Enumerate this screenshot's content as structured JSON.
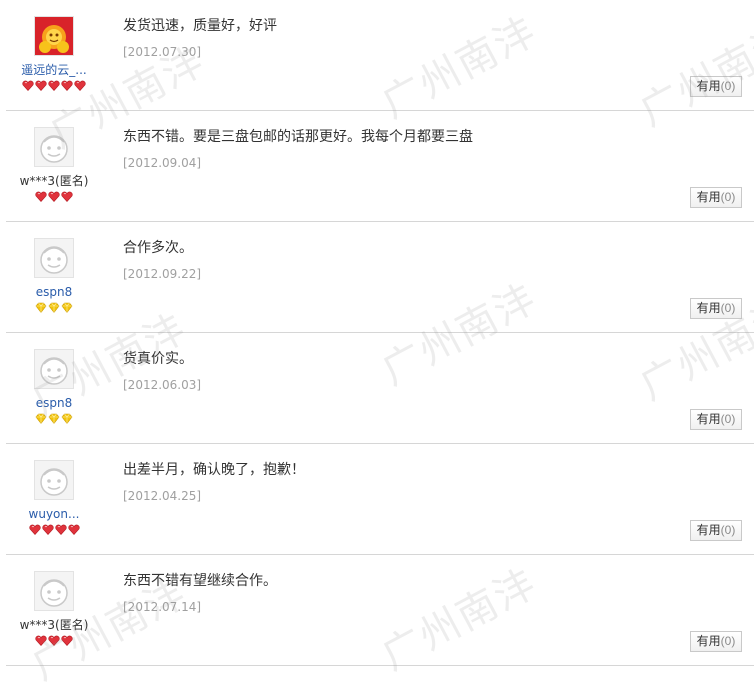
{
  "watermark_text": "广州南沣",
  "useful_label": "有用",
  "reviews": [
    {
      "username": "遥远的云_...",
      "username_style": "link",
      "avatar": "orange-cartoon-avatar",
      "badge_type": "red-heart",
      "badge_count": 5,
      "comment": "发货迅速，质量好，好评",
      "date": "[2012.07.30]",
      "useful_count": "(0)"
    },
    {
      "username": "w***3(匿名)",
      "username_style": "anon",
      "avatar": "default-face-avatar",
      "badge_type": "red-heart",
      "badge_count": 3,
      "comment": "东西不错。要是三盘包邮的话那更好。我每个月都要三盘",
      "date": "[2012.09.04]",
      "useful_count": "(0)"
    },
    {
      "username": "espn8",
      "username_style": "link",
      "avatar": "default-face-avatar",
      "badge_type": "yellow-diamond",
      "badge_count": 3,
      "comment": "合作多次。",
      "date": "[2012.09.22]",
      "useful_count": "(0)"
    },
    {
      "username": "espn8",
      "username_style": "link",
      "avatar": "default-face-avatar",
      "badge_type": "yellow-diamond",
      "badge_count": 3,
      "comment": "货真价实。",
      "date": "[2012.06.03]",
      "useful_count": "(0)"
    },
    {
      "username": "wuyon...",
      "username_style": "link",
      "avatar": "default-face-avatar",
      "badge_type": "red-heart",
      "badge_count": 4,
      "comment": "出差半月，确认晚了，抱歉！",
      "date": "[2012.04.25]",
      "useful_count": "(0)"
    },
    {
      "username": "w***3(匿名)",
      "username_style": "anon",
      "avatar": "default-face-avatar",
      "badge_type": "red-heart",
      "badge_count": 3,
      "comment": "东西不错有望继续合作。",
      "date": "[2012.07.14]",
      "useful_count": "(0)"
    }
  ]
}
